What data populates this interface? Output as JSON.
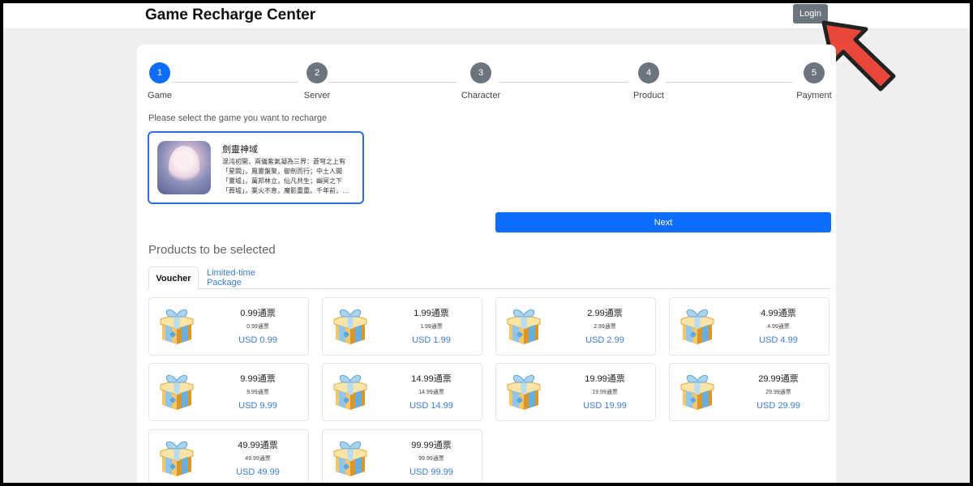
{
  "header": {
    "title": "Game Recharge Center",
    "login_label": "Login"
  },
  "steps": [
    {
      "number": "1",
      "label": "Game"
    },
    {
      "number": "2",
      "label": "Server"
    },
    {
      "number": "3",
      "label": "Character"
    },
    {
      "number": "4",
      "label": "Product"
    },
    {
      "number": "5",
      "label": "Payment"
    }
  ],
  "instruction": "Please select the game you want to recharge",
  "game": {
    "name": "劍靈神域",
    "description": "混沌初開，兩儀紫氣凝為三界：蒼穹之上有「星闕」，鳳靈盤聚，御劍而行；中土人間「靈墟」，萬邦林立，仙凡共生；幽冥之下「葬墟」，業火不息，魔影重重。千年前，…"
  },
  "next_label": "Next",
  "products_heading": "Products to be selected",
  "tabs": [
    {
      "label": "Voucher",
      "active": true
    },
    {
      "label": "Limited-time Package",
      "active": false
    }
  ],
  "products": [
    {
      "name": "0.99通票",
      "sub": "0.99通票",
      "price": "USD 0.99"
    },
    {
      "name": "1.99通票",
      "sub": "1.99通票",
      "price": "USD 1.99"
    },
    {
      "name": "2.99通票",
      "sub": "2.99通票",
      "price": "USD 2.99"
    },
    {
      "name": "4.99通票",
      "sub": "4.99通票",
      "price": "USD 4.99"
    },
    {
      "name": "9.99通票",
      "sub": "9.99通票",
      "price": "USD 9.99"
    },
    {
      "name": "14.99通票",
      "sub": "14.99通票",
      "price": "USD 14.99"
    },
    {
      "name": "19.99通票",
      "sub": "19.99通票",
      "price": "USD 19.99"
    },
    {
      "name": "29.99通票",
      "sub": "29.99通票",
      "price": "USD 29.99"
    },
    {
      "name": "49.99通票",
      "sub": "49.99通票",
      "price": "USD 49.99"
    },
    {
      "name": "99.99通票",
      "sub": "99.99通票",
      "price": "USD 99.99"
    }
  ],
  "colors": {
    "primary": "#0d6efd",
    "step_inactive": "#6c757d",
    "price": "#3b7dd8",
    "arrow": "#e8473a"
  },
  "icons": {
    "product": "gift-box-icon",
    "pointer": "arrow-pointer-icon"
  }
}
